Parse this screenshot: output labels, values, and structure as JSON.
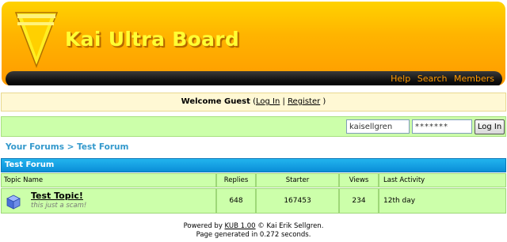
{
  "header": {
    "title": "Kai Ultra Board",
    "nav": [
      "Help",
      "Search",
      "Members"
    ]
  },
  "welcome": {
    "prefix": "Welcome Guest",
    "open_paren": "(",
    "login": "Log In",
    "separator": "|",
    "register": "Register",
    "close_paren": ")"
  },
  "login": {
    "username_value": "kaisellgren",
    "password_value": "*******",
    "button": "Log In"
  },
  "breadcrumb": {
    "root": "Your Forums",
    "separator": ">",
    "current": "Test Forum"
  },
  "forum": {
    "title": "Test Forum",
    "columns": [
      "Topic Name",
      "Replies",
      "Starter",
      "Views",
      "Last Activity"
    ],
    "rows": [
      {
        "title": "Test Topic!",
        "description": "this just a scam!",
        "replies": "648",
        "starter": "167453",
        "views": "234",
        "last_activity": "12th day"
      }
    ]
  },
  "footer": {
    "powered_prefix": "Powered by",
    "powered_link": "KUB 1.00",
    "powered_suffix": "© Kai Erik Sellgren.",
    "generated": "Page generated in 0.272 seconds."
  },
  "colors": {
    "header_orange": "#ffa500",
    "title_yellow": "#ffff33",
    "nav_orange": "#ff9900",
    "green_bar": "#ccffaa",
    "blue_bar": "#1a9fe0",
    "link_blue": "#3399cc"
  }
}
